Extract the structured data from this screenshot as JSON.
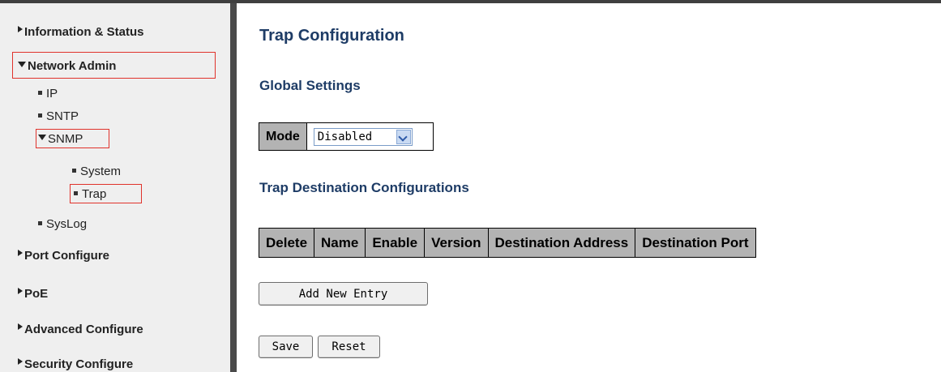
{
  "sidebar": {
    "information_status": "Information & Status",
    "network_admin": "Network Admin",
    "ip": "IP",
    "sntp": "SNTP",
    "snmp": "SNMP",
    "system": "System",
    "trap": "Trap",
    "syslog": "SysLog",
    "port_configure": "Port Configure",
    "poe": "PoE",
    "advanced_configure": "Advanced Configure",
    "security_configure": "Security Configure"
  },
  "main": {
    "title": "Trap Configuration",
    "global_settings": "Global Settings",
    "mode_label": "Mode",
    "mode_value": "Disabled",
    "trap_destination_title": "Trap Destination Configurations",
    "columns": [
      "Delete",
      "Name",
      "Enable",
      "Version",
      "Destination Address",
      "Destination Port"
    ],
    "add_new_entry": "Add New Entry",
    "save": "Save",
    "reset": "Reset"
  },
  "colors": {
    "heading": "#1e3c66",
    "highlight_box": "#e0322b",
    "table_header_bg": "#b3b3b3",
    "sidebar_bg": "#efefef"
  }
}
